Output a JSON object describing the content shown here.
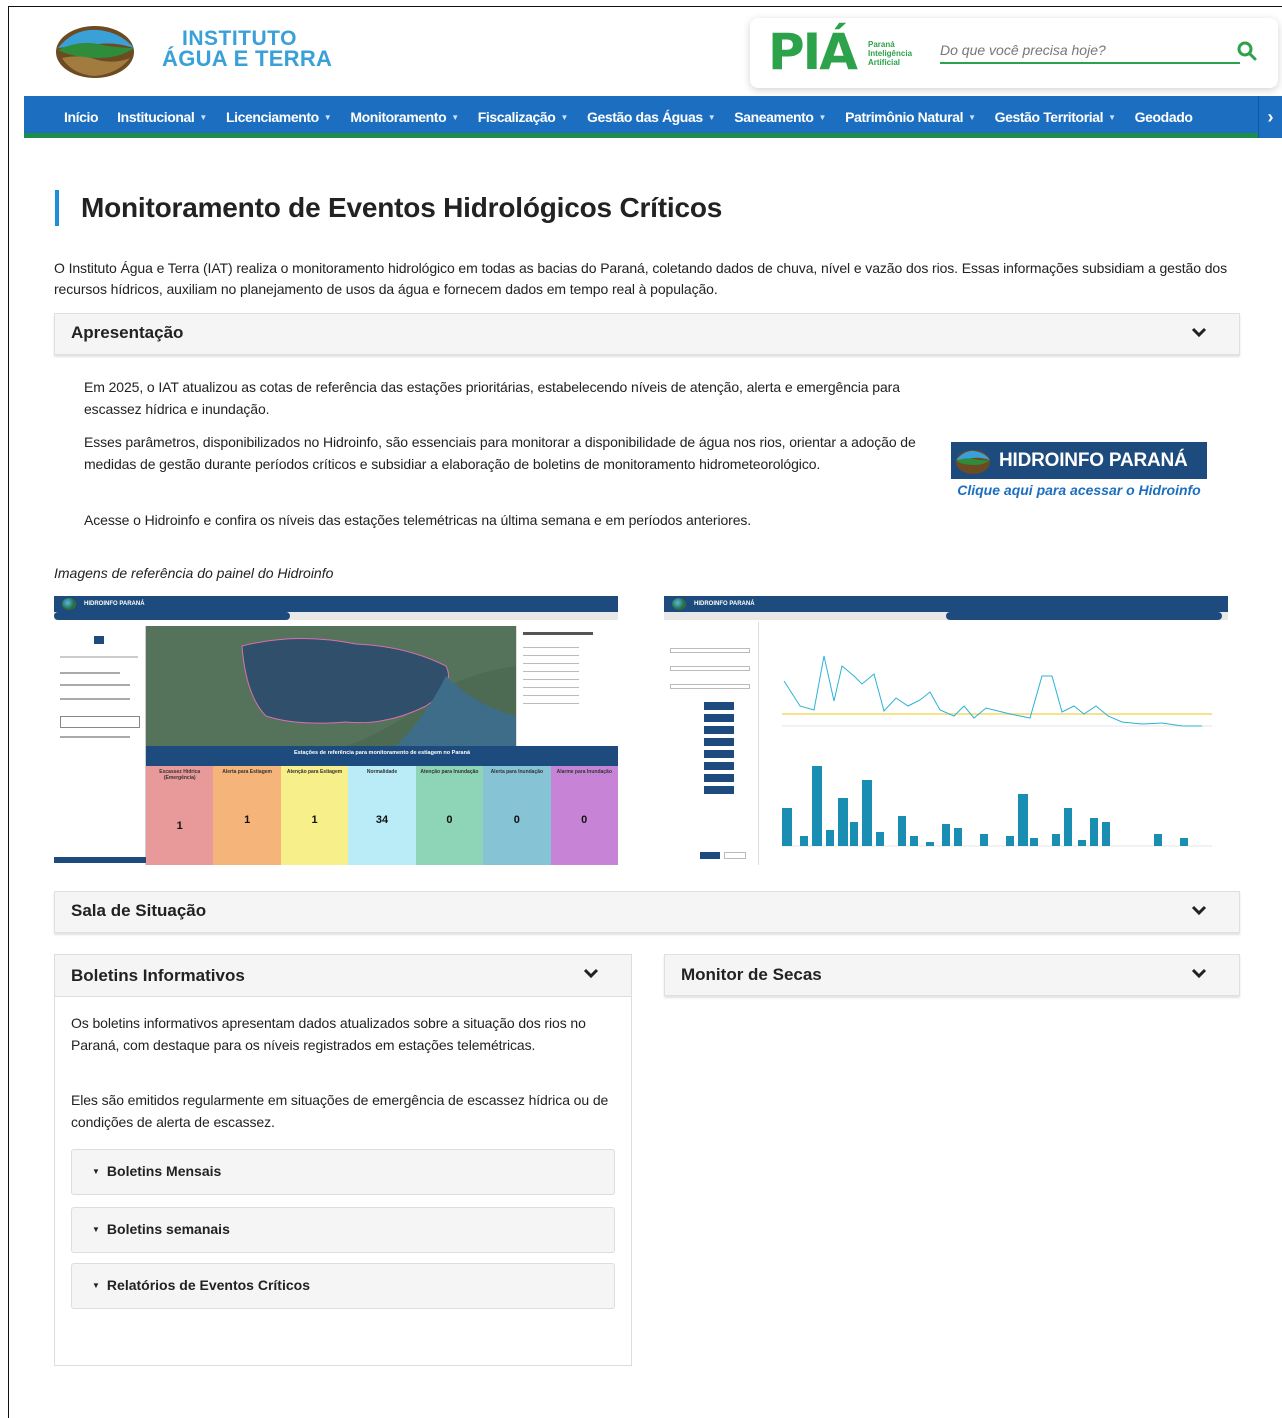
{
  "header": {
    "logo_line1": "INSTITUTO",
    "logo_line2": "ÁGUA E TERRA",
    "pia_logo": "PIÁ",
    "pia_sub": [
      "Paraná",
      "Inteligência",
      "Artificial"
    ],
    "search_placeholder": "Do que você precisa hoje?"
  },
  "nav": {
    "items": [
      {
        "label": "Início",
        "dropdown": false
      },
      {
        "label": "Institucional",
        "dropdown": true
      },
      {
        "label": "Licenciamento",
        "dropdown": true
      },
      {
        "label": "Monitoramento",
        "dropdown": true
      },
      {
        "label": "Fiscalização",
        "dropdown": true
      },
      {
        "label": "Gestão das Águas",
        "dropdown": true
      },
      {
        "label": "Saneamento",
        "dropdown": true
      },
      {
        "label": "Patrimônio Natural",
        "dropdown": true
      },
      {
        "label": "Gestão Territorial",
        "dropdown": true
      },
      {
        "label": "Geodado",
        "dropdown": false
      }
    ],
    "next_arrow": "›"
  },
  "page": {
    "title": "Monitoramento de Eventos Hidrológicos Críticos",
    "intro": "O Instituto Água e Terra (IAT) realiza o monitoramento hidrológico em todas as bacias do Paraná, coletando dados de chuva, nível e vazão dos rios. Essas informações subsidiam a gestão dos recursos hídricos, auxiliam no planejamento de usos da água e fornecem dados em tempo real à população."
  },
  "apresentacao": {
    "title": "Apresentação",
    "p1": "Em 2025, o IAT atualizou as cotas de referência das estações prioritárias, estabelecendo níveis de atenção, alerta e emergência para escassez hídrica e inundação.",
    "p2": "Esses parâmetros, disponibilizados no Hidroinfo, são essenciais para monitorar a disponibilidade de água nos rios, orientar a adoção de medidas de gestão durante períodos críticos e subsidiar a elaboração de boletins de monitoramento hidrometeorológico.",
    "p3": "Acesse o Hidroinfo e confira os níveis das estações telemétricas na última semana e em períodos anteriores.",
    "banner_text": "HIDROINFO PARANÁ",
    "banner_link": "Clique aqui para acessar o Hidroinfo"
  },
  "images": {
    "caption": "Imagens de referência do painel do Hidroinfo",
    "shot1_header": "HIDROINFO PARANÁ",
    "shot1_table_title": "Estações de referência para monitoramento de estiagem no Paraná",
    "shot1_cards": [
      {
        "label": "Escassez Hídrica (Emergência)",
        "value": "1",
        "color": "#e89a9a"
      },
      {
        "label": "Alerta para Estiagem",
        "value": "1",
        "color": "#f4b47a"
      },
      {
        "label": "Atenção para Estiagem",
        "value": "1",
        "color": "#f6ef8a"
      },
      {
        "label": "Normalidade",
        "value": "34",
        "color": "#b9ecf7"
      },
      {
        "label": "Atenção para Inundação",
        "value": "0",
        "color": "#8ed4b6"
      },
      {
        "label": "Alerta para Inundação",
        "value": "0",
        "color": "#86c3d4"
      },
      {
        "label": "Alarme para Inundação",
        "value": "0",
        "color": "#c784d6"
      }
    ],
    "shot2_header": "HIDROINFO PARANÁ"
  },
  "sala": {
    "title": "Sala de Situação"
  },
  "boletins": {
    "title": "Boletins Informativos",
    "p1": "Os boletins informativos apresentam dados atualizados sobre a situação dos rios no Paraná, com destaque para os níveis registrados em estações telemétricas.",
    "p2": "Eles são emitidos regularmente em situações de emergência de escassez hídrica ou de condições de alerta de escassez.",
    "items": [
      "Boletins Mensais",
      "Boletins semanais",
      "Relatórios de Eventos Críticos"
    ]
  },
  "monitor": {
    "title": "Monitor de Secas"
  },
  "colors": {
    "nav_blue": "#1c6fc0",
    "nav_green": "#1d8d4c",
    "accent": "#1c8fd9",
    "banner": "#1d4b7e"
  }
}
